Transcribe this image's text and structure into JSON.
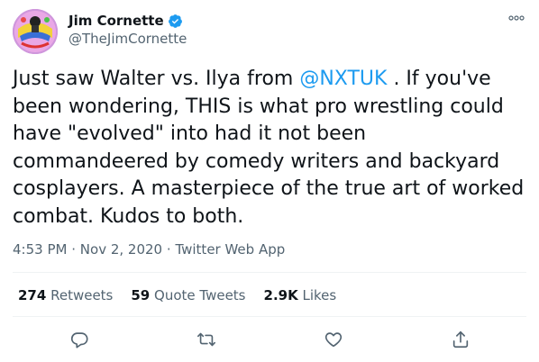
{
  "tweet": {
    "author": {
      "display_name": "Jim Cornette",
      "handle": "@TheJimCornette",
      "verified": true,
      "avatar_icon": "cartoon-avatar-icon"
    },
    "text_before": "Just saw Walter vs. Ilya from ",
    "mention": "@NXTUK",
    "text_after": " . If you've been wondering, THIS is what pro wrestling could have \"evolved\" into had it not been commandeered by comedy writers and backyard cosplayers. A masterpiece of the true art of worked combat. Kudos to both.",
    "time": "4:53 PM",
    "date": "Nov 2, 2020",
    "source": "Twitter Web App",
    "dot": "·"
  },
  "stats": {
    "retweets_count": "274",
    "retweets_label": "Retweets",
    "quotes_count": "59",
    "quotes_label": "Quote Tweets",
    "likes_count": "2.9K",
    "likes_label": "Likes"
  },
  "icons": {
    "verified": "verified-badge-icon",
    "more": "more-dots-icon",
    "reply": "reply-icon",
    "retweet": "retweet-icon",
    "like": "heart-icon",
    "share": "share-icon"
  },
  "colors": {
    "accent": "#1d9bf0",
    "text": "#0f1419",
    "secondary": "#536471",
    "divider": "#eff3f4"
  }
}
